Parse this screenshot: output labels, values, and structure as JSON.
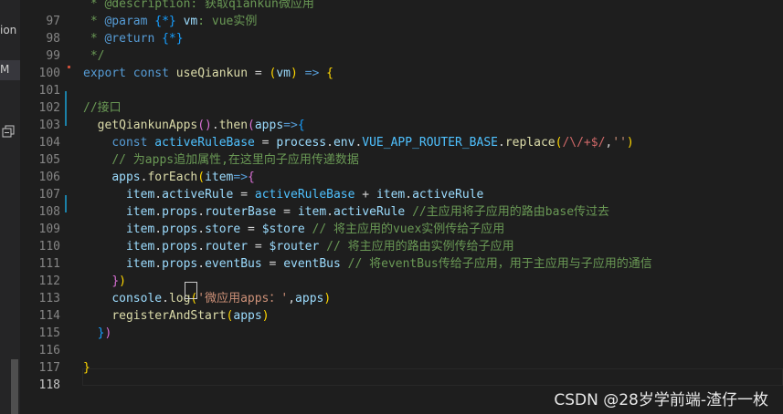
{
  "left_panel": {
    "text_top": "ion",
    "text_active": "M"
  },
  "editor": {
    "lines": [
      {
        "n": "",
        "t": [
          {
            "c": "cm",
            "v": " * @description: 获取qiankun微应用"
          }
        ]
      },
      {
        "n": "97",
        "t": [
          {
            "c": "cm",
            "v": " * "
          },
          {
            "c": "kw",
            "v": "@param"
          },
          {
            "c": "cm",
            "v": " "
          },
          {
            "c": "b3",
            "v": "{*}"
          },
          {
            "c": "cm",
            "v": " "
          },
          {
            "c": "var",
            "v": "vm"
          },
          {
            "c": "cm",
            "v": ": vue实例"
          }
        ]
      },
      {
        "n": "98",
        "t": [
          {
            "c": "cm",
            "v": " * "
          },
          {
            "c": "kw",
            "v": "@return"
          },
          {
            "c": "cm",
            "v": " "
          },
          {
            "c": "b3",
            "v": "{*}"
          }
        ]
      },
      {
        "n": "99",
        "t": [
          {
            "c": "cm",
            "v": " */"
          }
        ]
      },
      {
        "n": "100",
        "t": [
          {
            "c": "kw",
            "v": "export"
          },
          {
            "c": "pn",
            "v": " "
          },
          {
            "c": "kw",
            "v": "const"
          },
          {
            "c": "pn",
            "v": " "
          },
          {
            "c": "fn",
            "v": "useQiankun"
          },
          {
            "c": "pn",
            "v": " = "
          },
          {
            "c": "b1",
            "v": "("
          },
          {
            "c": "var",
            "v": "vm"
          },
          {
            "c": "b1",
            "v": ")"
          },
          {
            "c": "pn",
            "v": " "
          },
          {
            "c": "kw",
            "v": "=>"
          },
          {
            "c": "pn",
            "v": " "
          },
          {
            "c": "b1",
            "v": "{"
          }
        ]
      },
      {
        "n": "101",
        "t": []
      },
      {
        "n": "102",
        "t": [
          {
            "c": "cm",
            "v": "//接口"
          }
        ]
      },
      {
        "n": "103",
        "t": [
          {
            "c": "pn",
            "v": "  "
          },
          {
            "c": "fn",
            "v": "getQiankunApps"
          },
          {
            "c": "b2",
            "v": "()"
          },
          {
            "c": "pn",
            "v": "."
          },
          {
            "c": "fn",
            "v": "then"
          },
          {
            "c": "b2",
            "v": "("
          },
          {
            "c": "var",
            "v": "apps"
          },
          {
            "c": "kw",
            "v": "=>"
          },
          {
            "c": "b3",
            "v": "{"
          }
        ]
      },
      {
        "n": "104",
        "t": [
          {
            "c": "pn",
            "v": "    "
          },
          {
            "c": "kw",
            "v": "const"
          },
          {
            "c": "pn",
            "v": " "
          },
          {
            "c": "const",
            "v": "activeRuleBase"
          },
          {
            "c": "pn",
            "v": " = "
          },
          {
            "c": "var",
            "v": "process"
          },
          {
            "c": "pn",
            "v": "."
          },
          {
            "c": "var",
            "v": "env"
          },
          {
            "c": "pn",
            "v": "."
          },
          {
            "c": "const",
            "v": "VUE_APP_ROUTER_BASE"
          },
          {
            "c": "pn",
            "v": "."
          },
          {
            "c": "fn",
            "v": "replace"
          },
          {
            "c": "b1",
            "v": "("
          },
          {
            "c": "rx",
            "v": "/\\/+$/"
          },
          {
            "c": "pn",
            "v": ","
          },
          {
            "c": "str",
            "v": "''"
          },
          {
            "c": "b1",
            "v": ")"
          }
        ]
      },
      {
        "n": "105",
        "t": [
          {
            "c": "pn",
            "v": "    "
          },
          {
            "c": "cm",
            "v": "// 为apps追加属性,在这里向子应用传递数据"
          }
        ]
      },
      {
        "n": "106",
        "t": [
          {
            "c": "pn",
            "v": "    "
          },
          {
            "c": "var",
            "v": "apps"
          },
          {
            "c": "pn",
            "v": "."
          },
          {
            "c": "fn",
            "v": "forEach"
          },
          {
            "c": "b1",
            "v": "("
          },
          {
            "c": "var",
            "v": "item"
          },
          {
            "c": "kw",
            "v": "=>"
          },
          {
            "c": "b2",
            "v": "{"
          }
        ]
      },
      {
        "n": "107",
        "t": [
          {
            "c": "pn",
            "v": "      "
          },
          {
            "c": "var",
            "v": "item"
          },
          {
            "c": "pn",
            "v": "."
          },
          {
            "c": "var",
            "v": "activeRule"
          },
          {
            "c": "pn",
            "v": " = "
          },
          {
            "c": "const",
            "v": "activeRuleBase"
          },
          {
            "c": "pn",
            "v": " + "
          },
          {
            "c": "var",
            "v": "item"
          },
          {
            "c": "pn",
            "v": "."
          },
          {
            "c": "var",
            "v": "activeRule"
          }
        ]
      },
      {
        "n": "108",
        "t": [
          {
            "c": "pn",
            "v": "      "
          },
          {
            "c": "var",
            "v": "item"
          },
          {
            "c": "pn",
            "v": "."
          },
          {
            "c": "var",
            "v": "props"
          },
          {
            "c": "pn",
            "v": "."
          },
          {
            "c": "var",
            "v": "routerBase"
          },
          {
            "c": "pn",
            "v": " = "
          },
          {
            "c": "var",
            "v": "item"
          },
          {
            "c": "pn",
            "v": "."
          },
          {
            "c": "var",
            "v": "activeRule"
          },
          {
            "c": "pn",
            "v": " "
          },
          {
            "c": "cm",
            "v": "//主应用将子应用的路由base传过去"
          }
        ]
      },
      {
        "n": "109",
        "t": [
          {
            "c": "pn",
            "v": "      "
          },
          {
            "c": "var",
            "v": "item"
          },
          {
            "c": "pn",
            "v": "."
          },
          {
            "c": "var",
            "v": "props"
          },
          {
            "c": "pn",
            "v": "."
          },
          {
            "c": "var",
            "v": "store"
          },
          {
            "c": "pn",
            "v": " = "
          },
          {
            "c": "var",
            "v": "$store"
          },
          {
            "c": "pn",
            "v": " "
          },
          {
            "c": "cm",
            "v": "// 将主应用的vuex实例传给子应用"
          }
        ]
      },
      {
        "n": "110",
        "t": [
          {
            "c": "pn",
            "v": "      "
          },
          {
            "c": "var",
            "v": "item"
          },
          {
            "c": "pn",
            "v": "."
          },
          {
            "c": "var",
            "v": "props"
          },
          {
            "c": "pn",
            "v": "."
          },
          {
            "c": "var",
            "v": "router"
          },
          {
            "c": "pn",
            "v": " = "
          },
          {
            "c": "var",
            "v": "$router"
          },
          {
            "c": "pn",
            "v": " "
          },
          {
            "c": "cm",
            "v": "// 将主应用的路由实例传给子应用"
          }
        ]
      },
      {
        "n": "111",
        "t": [
          {
            "c": "pn",
            "v": "      "
          },
          {
            "c": "var",
            "v": "item"
          },
          {
            "c": "pn",
            "v": "."
          },
          {
            "c": "var",
            "v": "props"
          },
          {
            "c": "pn",
            "v": "."
          },
          {
            "c": "var",
            "v": "eventBus"
          },
          {
            "c": "pn",
            "v": " = "
          },
          {
            "c": "var",
            "v": "eventBus"
          },
          {
            "c": "pn",
            "v": " "
          },
          {
            "c": "cm",
            "v": "// 将eventBus传给子应用，用于主应用与子应用的通信"
          }
        ]
      },
      {
        "n": "112",
        "t": [
          {
            "c": "pn",
            "v": "    "
          },
          {
            "c": "b2",
            "v": "}"
          },
          {
            "c": "b1",
            "v": ")"
          }
        ]
      },
      {
        "n": "113",
        "t": [
          {
            "c": "pn",
            "v": "    "
          },
          {
            "c": "var",
            "v": "console"
          },
          {
            "c": "pn",
            "v": "."
          },
          {
            "c": "fn",
            "v": "log"
          },
          {
            "c": "b1",
            "v": "("
          },
          {
            "c": "str",
            "v": "'微应用apps："
          },
          {
            "c": "str",
            "v": "'"
          },
          {
            "c": "pn",
            "v": ","
          },
          {
            "c": "var",
            "v": "apps"
          },
          {
            "c": "b1",
            "v": ")"
          }
        ]
      },
      {
        "n": "114",
        "t": [
          {
            "c": "pn",
            "v": "    "
          },
          {
            "c": "fn",
            "v": "registerAndStart"
          },
          {
            "c": "b1",
            "v": "("
          },
          {
            "c": "var",
            "v": "apps"
          },
          {
            "c": "b1",
            "v": ")"
          }
        ]
      },
      {
        "n": "115",
        "t": [
          {
            "c": "pn",
            "v": "  "
          },
          {
            "c": "b3",
            "v": "}"
          },
          {
            "c": "b2",
            "v": ")"
          }
        ]
      },
      {
        "n": "116",
        "t": []
      },
      {
        "n": "117",
        "t": [
          {
            "c": "b1",
            "v": "}"
          }
        ]
      },
      {
        "n": "118",
        "t": []
      }
    ]
  },
  "watermark": "CSDN @28岁学前端-渣仔一枚"
}
